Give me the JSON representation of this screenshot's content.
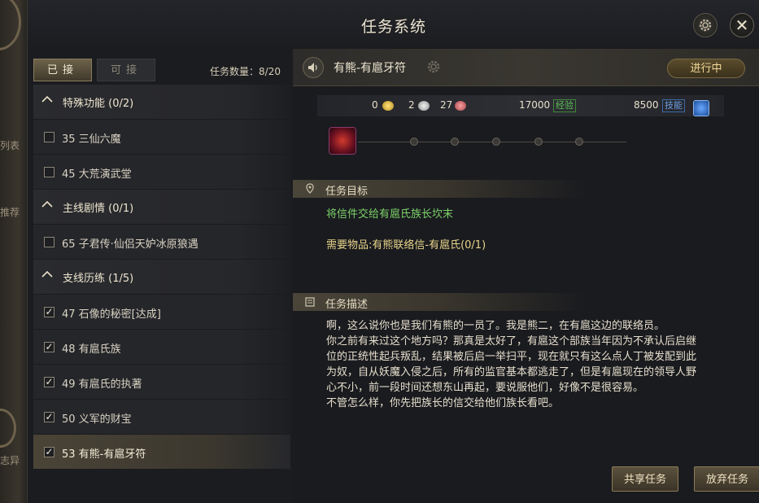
{
  "window": {
    "title": "任务系统"
  },
  "side_menu": {
    "item_1": "列表",
    "item_2": "推荐",
    "item_3": "志异"
  },
  "tabs": {
    "accepted": "已接",
    "available": "可接"
  },
  "quest_count": "任务数量：8/20",
  "quest_list": [
    {
      "type": "category",
      "label": "特殊功能 (0/2)"
    },
    {
      "type": "quest",
      "label": "35 三仙六魔",
      "checked": false
    },
    {
      "type": "quest",
      "label": "45 大荒演武堂",
      "checked": false
    },
    {
      "type": "category",
      "label": "主线剧情 (0/1)"
    },
    {
      "type": "quest",
      "label": "65 子君传·仙侣天妒冰原狼遇",
      "checked": false
    },
    {
      "type": "category",
      "label": "支线历练 (1/5)"
    },
    {
      "type": "quest",
      "label": "47 石像的秘密[达成]",
      "checked": true
    },
    {
      "type": "quest",
      "label": "48 有扈氏族",
      "checked": true
    },
    {
      "type": "quest",
      "label": "49 有扈氏的执著",
      "checked": true
    },
    {
      "type": "quest",
      "label": "50 义军的财宝",
      "checked": true
    },
    {
      "type": "quest",
      "label": "53 有熊-有扈牙符",
      "checked": true,
      "selected": true
    }
  ],
  "quest_detail": {
    "name": "有熊-有扈牙符",
    "status": "进行中",
    "rewards": {
      "gold": "0",
      "silver": "2",
      "copper": "27",
      "exp": "17000",
      "exp_label": "经验",
      "skill": "8500",
      "skill_label": "技能"
    },
    "goal_title": "任务目标",
    "goal": "将信件交给有扈氏族长坎末",
    "required": "需要物品:有熊联络信-有扈氏(0/1)",
    "desc_title": "任务描述",
    "description": [
      "啊，这么说你也是我们有熊的一员了。我是熊二，在有扈这边的联络员。",
      "你之前有来过这个地方吗？那真是太好了，有扈这个部族当年因为不承认后启继",
      "位的正统性起兵叛乱，结果被后启一举扫平，现在就只有这么点人丁被发配到此",
      "为奴，自从妖魔入侵之后，所有的监官基本都逃走了，但是有扈现在的领导人野",
      "心不小，前一段时间还想东山再起，要说服他们，好像不是很容易。",
      "不管怎么样，你先把族长的信交给他们族长看吧。"
    ]
  },
  "buttons": {
    "share": "共享任务",
    "abandon": "放弃任务"
  },
  "colors": {
    "goal_green": "#7dd36a",
    "required_yellow": "#e8d48a",
    "accent_gold": "#f2dc9a"
  }
}
